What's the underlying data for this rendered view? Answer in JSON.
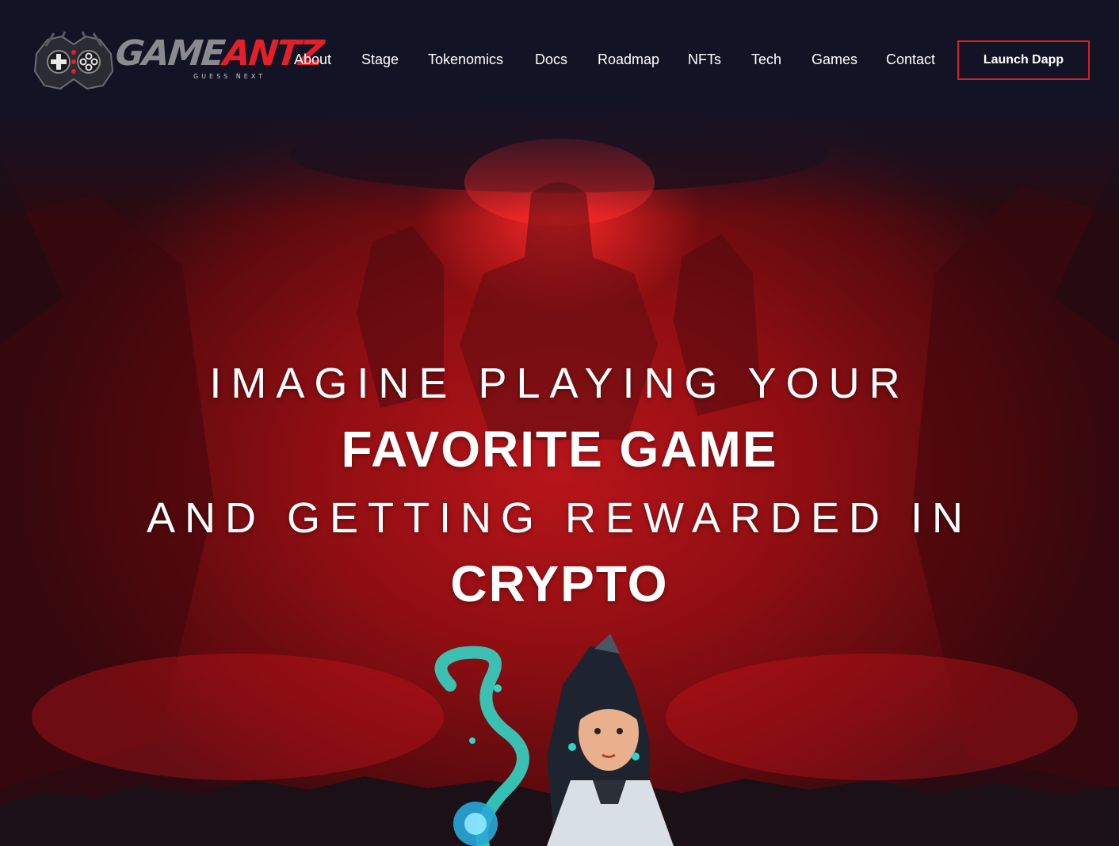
{
  "brand": {
    "name_part1": "GAME",
    "name_part2": "ANTZ",
    "tagline": "GUESS NEXT",
    "accent_color": "#e3202a"
  },
  "nav": {
    "items": [
      {
        "label": "About"
      },
      {
        "label": "Stage"
      },
      {
        "label": "Tokenomics"
      },
      {
        "label": "Docs"
      },
      {
        "label": "Roadmap"
      },
      {
        "label": "NFTs"
      },
      {
        "label": "Tech"
      },
      {
        "label": "Games"
      },
      {
        "label": "Contact"
      }
    ],
    "cta_label": "Launch Dapp",
    "cta_border_color": "#d42027"
  },
  "hero": {
    "line1": "IMAGINE PLAYING YOUR",
    "line2": "FAVORITE GAME",
    "line3": "AND GETTING REWARDED IN",
    "line4": "CRYPTO",
    "background_color": "#8e0e12"
  }
}
